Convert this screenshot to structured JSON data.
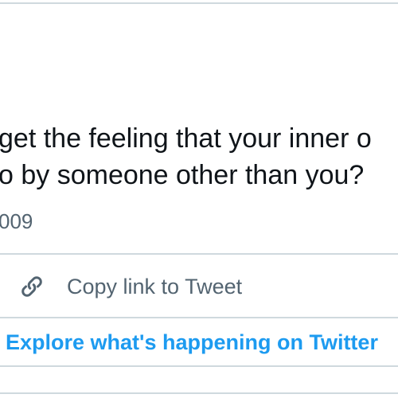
{
  "tweet": {
    "text_line_1": "get the feeling that your inner o",
    "text_line_2": "o by someone other than you?",
    "date_fragment": "009"
  },
  "actions": {
    "copy_link_label": "Copy link to Tweet",
    "copy_link_icon": "link-icon"
  },
  "footer": {
    "explore_label": "Explore what's happening on Twitter"
  },
  "colors": {
    "text_primary": "#0f1419",
    "text_secondary": "#536471",
    "link_blue": "#1d9bf0",
    "divider": "#cfd9de"
  }
}
